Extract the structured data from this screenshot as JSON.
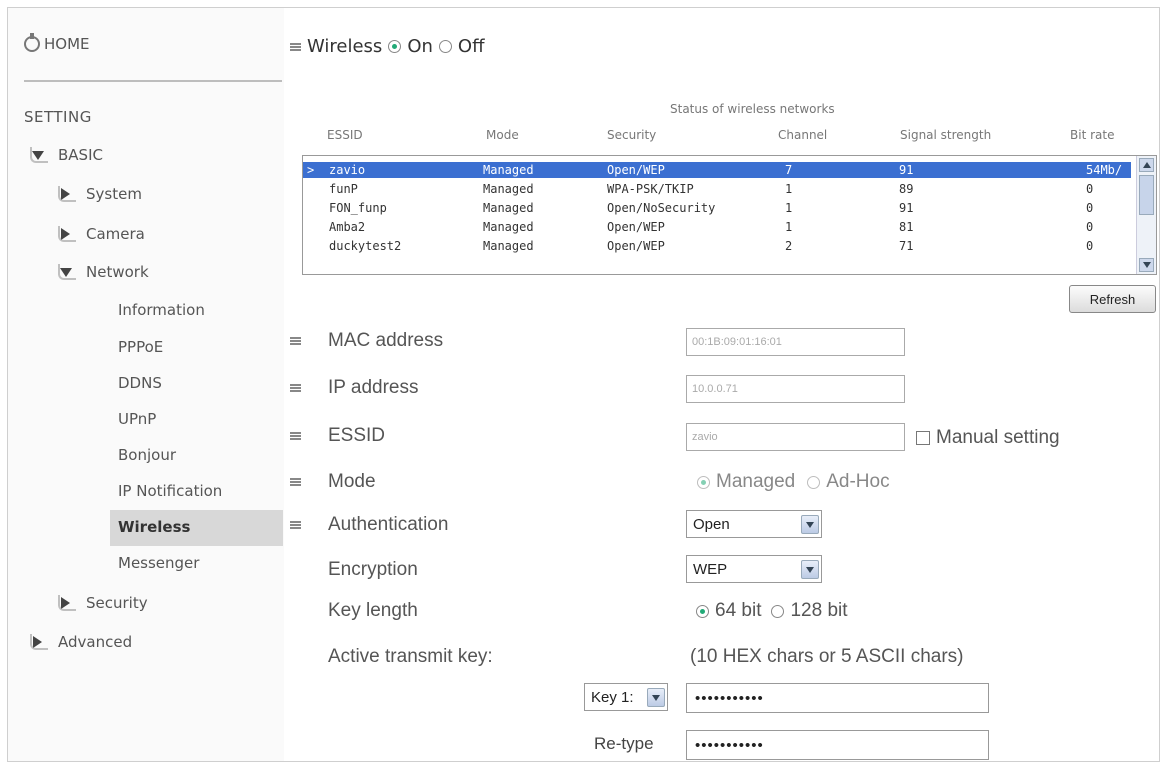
{
  "sidebar": {
    "home_label": "HOME",
    "setting_heading": "SETTING",
    "basic_label": "BASIC",
    "system_label": "System",
    "camera_label": "Camera",
    "network_label": "Network",
    "network_items": [
      "Information",
      "PPPoE",
      "DDNS",
      "UPnP",
      "Bonjour",
      "IP Notification",
      "Wireless",
      "Messenger"
    ],
    "security_label": "Security",
    "advanced_label": "Advanced"
  },
  "wireless": {
    "label": "Wireless",
    "on_label": "On",
    "off_label": "Off",
    "state": "On"
  },
  "networks": {
    "caption": "Status of wireless networks",
    "columns": [
      "ESSID",
      "Mode",
      "Security",
      "Channel",
      "Signal strength",
      "Bit rate"
    ],
    "rows": [
      {
        "marker": ">",
        "essid": "zavio",
        "mode": "Managed",
        "security": "Open/WEP",
        "channel": "7",
        "signal": "91",
        "bitrate": "54Mb/",
        "selected": true
      },
      {
        "marker": "",
        "essid": "funP",
        "mode": "Managed",
        "security": "WPA-PSK/TKIP",
        "channel": "1",
        "signal": "89",
        "bitrate": "0",
        "selected": false
      },
      {
        "marker": "",
        "essid": "FON_funp",
        "mode": "Managed",
        "security": "Open/NoSecurity",
        "channel": "1",
        "signal": "91",
        "bitrate": "0",
        "selected": false
      },
      {
        "marker": "",
        "essid": "Amba2",
        "mode": "Managed",
        "security": "Open/WEP",
        "channel": "1",
        "signal": "81",
        "bitrate": "0",
        "selected": false
      },
      {
        "marker": "",
        "essid": "duckytest2",
        "mode": "Managed",
        "security": "Open/WEP",
        "channel": "2",
        "signal": "71",
        "bitrate": "0",
        "selected": false
      }
    ],
    "refresh_label": "Refresh"
  },
  "form": {
    "mac_label": "MAC address",
    "mac_value": "00:1B:09:01:16:01",
    "ip_label": "IP address",
    "ip_value": "10.0.0.71",
    "essid_label": "ESSID",
    "essid_value": "zavio",
    "manual_setting_label": "Manual setting",
    "mode_label": "Mode",
    "mode_managed": "Managed",
    "mode_adhoc": "Ad-Hoc",
    "auth_label": "Authentication",
    "auth_value": "Open",
    "encryption_label": "Encryption",
    "encryption_value": "WEP",
    "keylength_label": "Key length",
    "key64_label": "64 bit",
    "key128_label": "128 bit",
    "active_key_label": "Active transmit key:",
    "active_key_hint": "(10 HEX chars or 5 ASCII chars)",
    "key_select_value": "Key 1:",
    "key_value": "•••••••••••",
    "retype_label": "Re-type",
    "retype_value": "•••••••••••"
  },
  "colors": {
    "selection": "#3b6fd1",
    "sidebar_active": "#d8d8d8",
    "radio_on": "#22aa77"
  }
}
